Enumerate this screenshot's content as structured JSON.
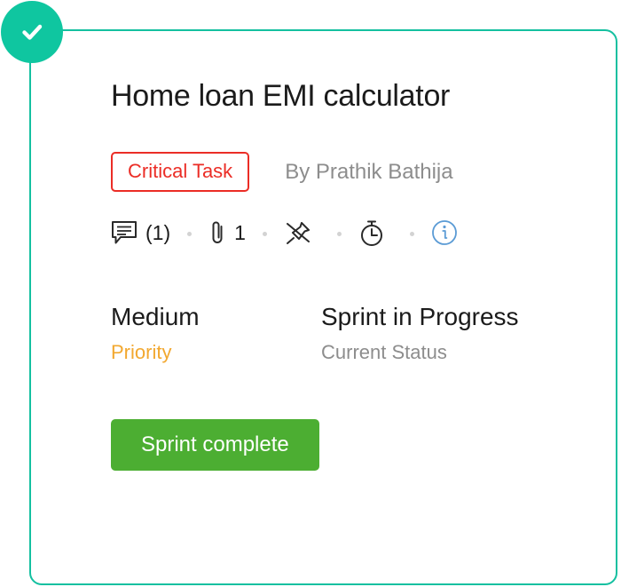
{
  "card": {
    "accent_color": "#14c0a0",
    "status_badge": {
      "icon": "check-icon",
      "color": "#0fc6a0"
    },
    "title": "Home loan EMI calculator",
    "priority_tag": {
      "label": "Critical Task",
      "color": "#eb2d26"
    },
    "author": "By Prathik Bathija",
    "icon_row": [
      {
        "icon": "comment-icon",
        "count": "(1)"
      },
      {
        "icon": "paperclip-icon",
        "count": "1"
      },
      {
        "icon": "pin-off-icon",
        "count": ""
      },
      {
        "icon": "stopwatch-icon",
        "count": ""
      },
      {
        "icon": "info-icon",
        "count": "",
        "color": "#4a90e2"
      }
    ],
    "fields": [
      {
        "value": "Medium",
        "label": "Priority",
        "label_color": "#f2a830"
      },
      {
        "value": "Sprint in Progress",
        "label": "Current Status",
        "label_color": "#8d8d8d"
      }
    ],
    "action": {
      "label": "Sprint complete",
      "color": "#4cae32"
    }
  }
}
